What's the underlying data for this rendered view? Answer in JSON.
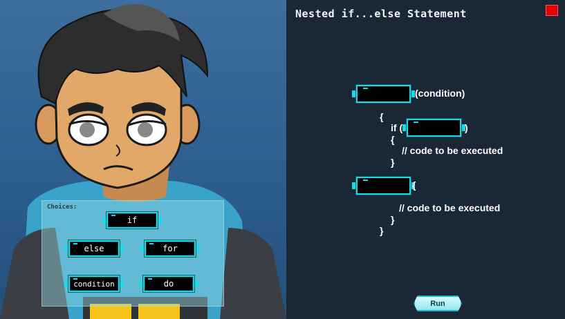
{
  "scene": {
    "character": "cartoon-boy-character"
  },
  "choices": {
    "title": "Choices:",
    "items": [
      {
        "label": "if"
      },
      {
        "label": "else"
      },
      {
        "label": "for"
      },
      {
        "label": "condition"
      },
      {
        "label": "do"
      }
    ]
  },
  "panel": {
    "title": "Nested if...else Statement",
    "code": {
      "line1_suffix": "(condition)",
      "open_brace_1": "{",
      "inner_if_prefix": "if (",
      "inner_if_suffix": ")",
      "open_brace_2": "{",
      "comment_1": "// code to be executed",
      "close_brace_2": "}",
      "after_slot_brace": "{",
      "comment_2": "// code to be executed",
      "close_brace_3": "}",
      "close_brace_4": "}"
    },
    "run_label": "Run"
  },
  "colors": {
    "accent": "#1fd7e4",
    "close_button": "#e60000",
    "panel_bg": "#1a2735"
  }
}
